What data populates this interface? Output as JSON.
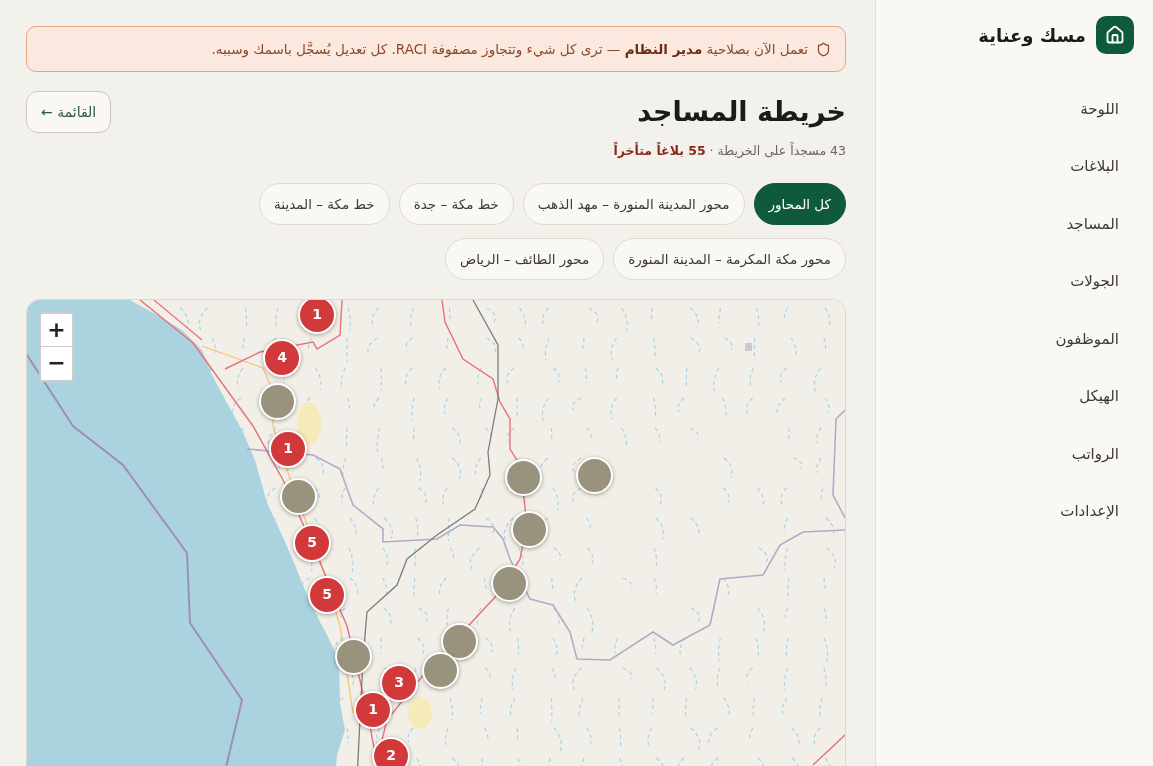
{
  "sidebar": {
    "brand": "مسك وعناية",
    "items": [
      "اللوحة",
      "البلاغات",
      "المساجد",
      "الجولات",
      "الموظفون",
      "الهيكل",
      "الرواتب",
      "الإعدادات"
    ]
  },
  "banner": {
    "text": "تعمل الآن بصلاحية **مدير النظام** — ترى كل شيء وتتجاوز مصفوفة RACI. كل تعديل يُسجَّل باسمك وسببه."
  },
  "header": {
    "title": "خريطة المساجد",
    "subtitle": "43 مسجداً على الخريطة · **55 بلاغاً متأخراً**",
    "back_button": "القائمة ←"
  },
  "filters": [
    {
      "label": "كل المحاور",
      "selected": true
    },
    {
      "label": "محور المدينة المنورة – مهد الذهب",
      "selected": false
    },
    {
      "label": "خط مكة – جدة",
      "selected": false
    },
    {
      "label": "خط مكة – المدينة",
      "selected": false
    },
    {
      "label": "محور مكة المكرمة – المدينة المنورة",
      "selected": false
    },
    {
      "label": "محور الطائف – الرياض",
      "selected": false
    }
  ],
  "map": {
    "zoom_controls": [
      "+",
      "−"
    ],
    "markers": [
      {
        "kind": "count",
        "label": "1"
      },
      {
        "kind": "count",
        "label": "4"
      },
      {
        "kind": "plain"
      },
      {
        "kind": "count",
        "label": "1"
      },
      {
        "kind": "plain"
      },
      {
        "kind": "plain"
      },
      {
        "kind": "plain"
      },
      {
        "kind": "plain"
      },
      {
        "kind": "count",
        "label": "5"
      },
      {
        "kind": "plain"
      },
      {
        "kind": "count",
        "label": "5"
      },
      {
        "kind": "plain"
      },
      {
        "kind": "plain"
      },
      {
        "kind": "plain"
      },
      {
        "kind": "count",
        "label": "3"
      },
      {
        "kind": "count",
        "label": "1"
      },
      {
        "kind": "count",
        "label": "2"
      }
    ]
  }
}
